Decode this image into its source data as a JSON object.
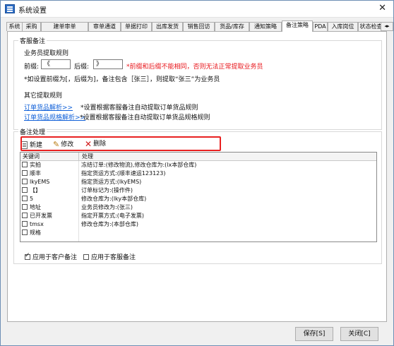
{
  "window": {
    "title": "系统设置"
  },
  "tabs": [
    {
      "label": "系统"
    },
    {
      "label": "采购"
    },
    {
      "label": "建单审单"
    },
    {
      "label": "审单通道"
    },
    {
      "label": "单据打印"
    },
    {
      "label": "出库发货"
    },
    {
      "label": "销售回访"
    },
    {
      "label": "货品/库存"
    },
    {
      "label": "通知策略"
    },
    {
      "label": "备注策略"
    },
    {
      "label": "PDA"
    },
    {
      "label": "入库岗位"
    },
    {
      "label": "状态检查"
    }
  ],
  "tab_scroll": "◂▸",
  "customer_service_note": {
    "group_title": "客服备注",
    "subtitle": "业务员提取规则",
    "prefix_label": "前缀:",
    "prefix_value": "《",
    "suffix_label": "后缀:",
    "suffix_value": "》",
    "warning": "*前缀和后缀不能相同，否则无法正常提取业务员",
    "example": "*如设置前缀为[，后缀为]，备注包含［张三］，则提取“张三”为业务员"
  },
  "other_rules": {
    "title": "其它提取规则",
    "order_goods_link": "订单货品解析>>",
    "order_goods_desc": "*设置根据客服备注自动提取订单货品规则",
    "order_spec_link": "订单货品规格解析>>",
    "order_spec_desc": "*设置根据客服备注自动提取订单货品规格规则"
  },
  "note_processing": {
    "group_title": "备注处理",
    "toolbar": {
      "new_label": "新建",
      "edit_label": "修改",
      "delete_label": "删除"
    },
    "columns": [
      "关键词",
      "处理"
    ],
    "rows": [
      {
        "keyword": "实拍",
        "action": "冻结订单:(修改物流),修改仓库为:(lx本部仓库)"
      },
      {
        "keyword": "顺丰",
        "action": "指定货运方式:(顺丰速运123123)"
      },
      {
        "keyword": "lkyEMS",
        "action": "指定货运方式:(lkyEMS)"
      },
      {
        "keyword": "【】",
        "action": "订单标记为:(操作件)"
      },
      {
        "keyword": "5",
        "action": "修改仓库为:(lky本部仓库)"
      },
      {
        "keyword": "地址",
        "action": "业务员修改为:(张三)"
      },
      {
        "keyword": "已开发票",
        "action": "指定开票方式:(电子发票)"
      },
      {
        "keyword": "tmsx",
        "action": "修改仓库为:(本部仓库)"
      },
      {
        "keyword": "规格",
        "action": ""
      }
    ],
    "apply_customer_label": "应用于客户备注",
    "apply_customer_checked": true,
    "apply_service_label": "应用于客服备注",
    "apply_service_checked": false
  },
  "footer": {
    "save_label": "保存[S]",
    "close_label": "关闭[C]"
  },
  "colors": {
    "warning": "#e8141a",
    "link": "#1060d8",
    "highlight": "#e82020"
  }
}
